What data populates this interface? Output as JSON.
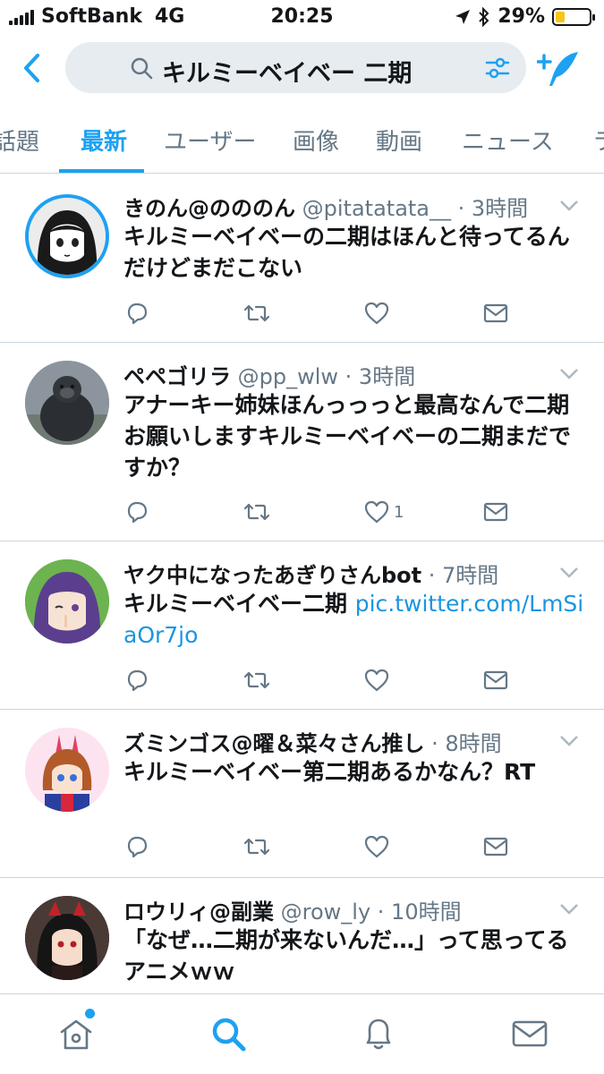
{
  "status_bar": {
    "carrier": "SoftBank",
    "network": "4G",
    "time": "20:25",
    "battery_percent": "29%",
    "battery_level": 0.29,
    "battery_color": "#f5c518"
  },
  "search": {
    "query": "キルミーベイベー 二期",
    "icon": "search-icon"
  },
  "tabs": [
    {
      "label": "話題",
      "active": false
    },
    {
      "label": "最新",
      "active": true
    },
    {
      "label": "ユーザー",
      "active": false
    },
    {
      "label": "画像",
      "active": false
    },
    {
      "label": "動画",
      "active": false
    },
    {
      "label": "ニュース",
      "active": false
    },
    {
      "label": "ラ",
      "active": false
    }
  ],
  "accent_color": "#1da1f2",
  "tweets": [
    {
      "name": "きのん@のののん",
      "meta": "@pitatatata__ · 3時間",
      "text": "キルミーベイベーの二期はほんと待ってるんだけどまだこない",
      "avatar": "anime-girl-avatar",
      "like_count": ""
    },
    {
      "name": "ペペゴリラ",
      "meta": "@pp_wlw · 3時間",
      "text": "アナーキー姉妹ほんっっっと最高なんで二期お願いしますキルミーベイベーの二期まだですか？",
      "avatar": "gorilla-avatar",
      "like_count": "1"
    },
    {
      "name": "ヤク中になったあぎりさんbot",
      "meta": " · 7時間",
      "text": "キルミーベイベー二期 ",
      "link": "pic.twitter.com/LmSiaOr7jo",
      "avatar": "agiri-avatar",
      "like_count": ""
    },
    {
      "name": "ズミンゴス@曜＆菜々さん推し",
      "meta": " · 8時間",
      "text": "キルミーベイベー第二期あるかなん？RT",
      "avatar": "pink-anime-avatar",
      "like_count": ""
    },
    {
      "name": "ロウリィ@副業",
      "meta": "@row_ly · 10時間",
      "text": "「なぜ…二期が来ないんだ…」って思ってるアニメｗｗ",
      "avatar": "rory-avatar",
      "like_count": ""
    }
  ],
  "bottom_nav": [
    "home-icon",
    "search-icon",
    "notifications-icon",
    "messages-icon"
  ]
}
